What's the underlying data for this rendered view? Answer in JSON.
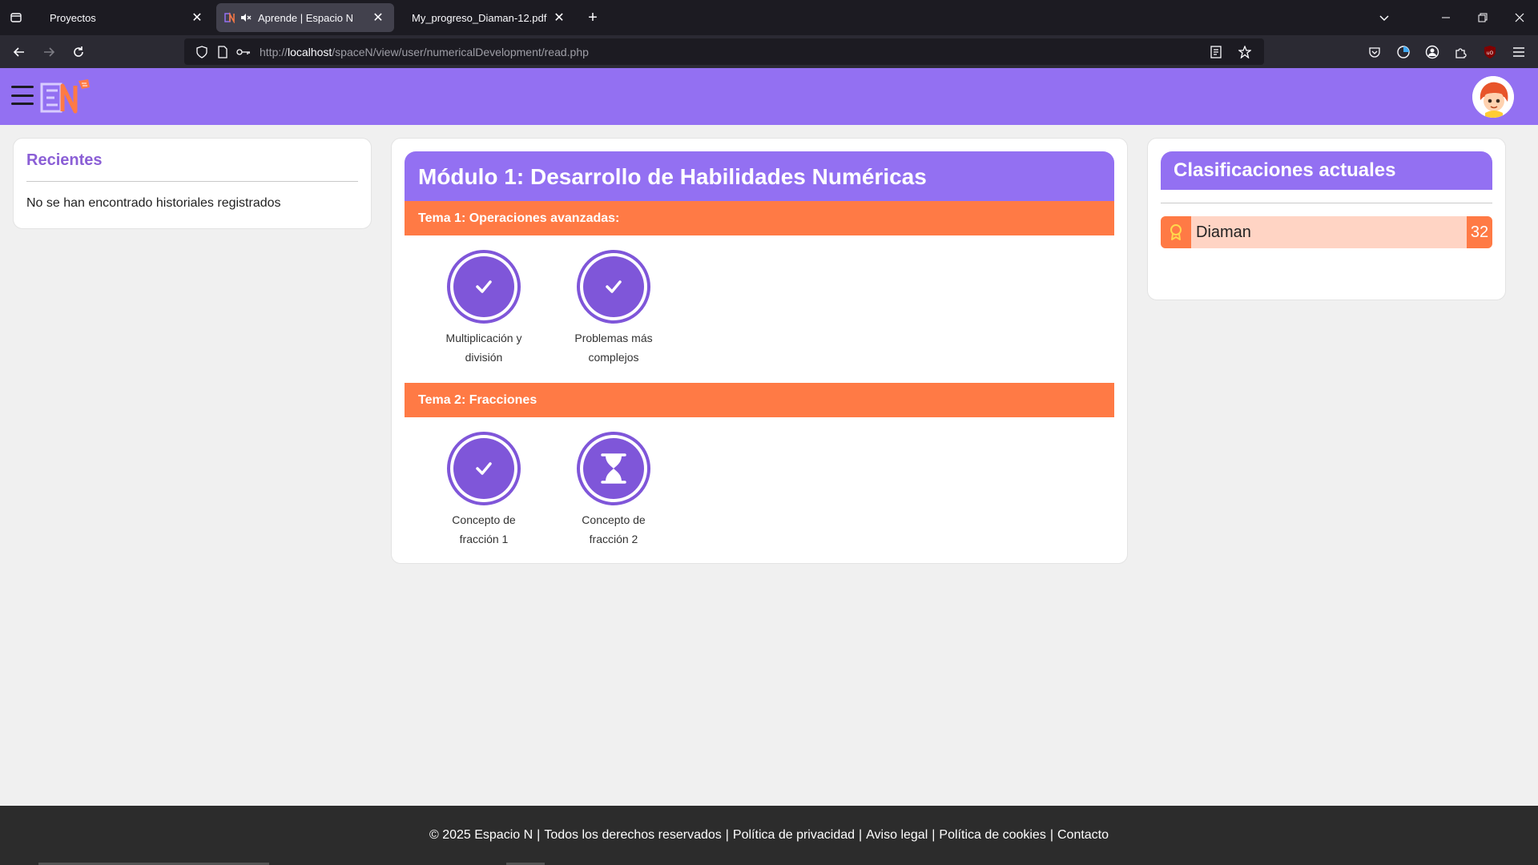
{
  "browser": {
    "tabs": [
      {
        "title": "Proyectos",
        "active": false
      },
      {
        "title": "Aprende | Espacio N",
        "active": true,
        "muted": true
      },
      {
        "title": "My_progreso_Diaman-12.pdf",
        "active": false
      }
    ],
    "url": {
      "prefix": "http://",
      "host": "localhost",
      "path": "/spaceN/view/user/numericalDevelopment/read.php"
    }
  },
  "recent": {
    "title": "Recientes",
    "empty_text": "No se han encontrado historiales registrados"
  },
  "module": {
    "title": "Módulo 1: Desarrollo de Habilidades Numéricas",
    "themes": [
      {
        "title": "Tema 1: Operaciones avanzadas:",
        "lessons": [
          {
            "line1": "Multiplicación y",
            "line2": "división",
            "status": "completed",
            "icon": "check-icon"
          },
          {
            "line1": "Problemas más",
            "line2": "complejos",
            "status": "completed",
            "icon": "check-icon"
          }
        ]
      },
      {
        "title": "Tema 2: Fracciones",
        "lessons": [
          {
            "line1": "Concepto de",
            "line2": "fracción 1",
            "status": "completed",
            "icon": "check-icon"
          },
          {
            "line1": "Concepto de",
            "line2": "fracción 2",
            "status": "pending",
            "icon": "hourglass-icon"
          }
        ]
      }
    ]
  },
  "classifications": {
    "title": "Clasificaciones actuales",
    "rows": [
      {
        "name": "Diaman",
        "count": "32",
        "icon": "medal-icon"
      }
    ]
  },
  "footer": {
    "copyright": "© 2025 Espacio N",
    "rights": "Todos los derechos reservados",
    "privacy": "Política de privacidad",
    "legal": "Aviso legal",
    "cookies": "Política de cookies",
    "contact": "Contacto"
  },
  "colors": {
    "header_purple": "#9370f2",
    "lesson_purple": "#7f56d9",
    "orange": "#ff7a45",
    "rank_bg": "#ffd4c4"
  }
}
